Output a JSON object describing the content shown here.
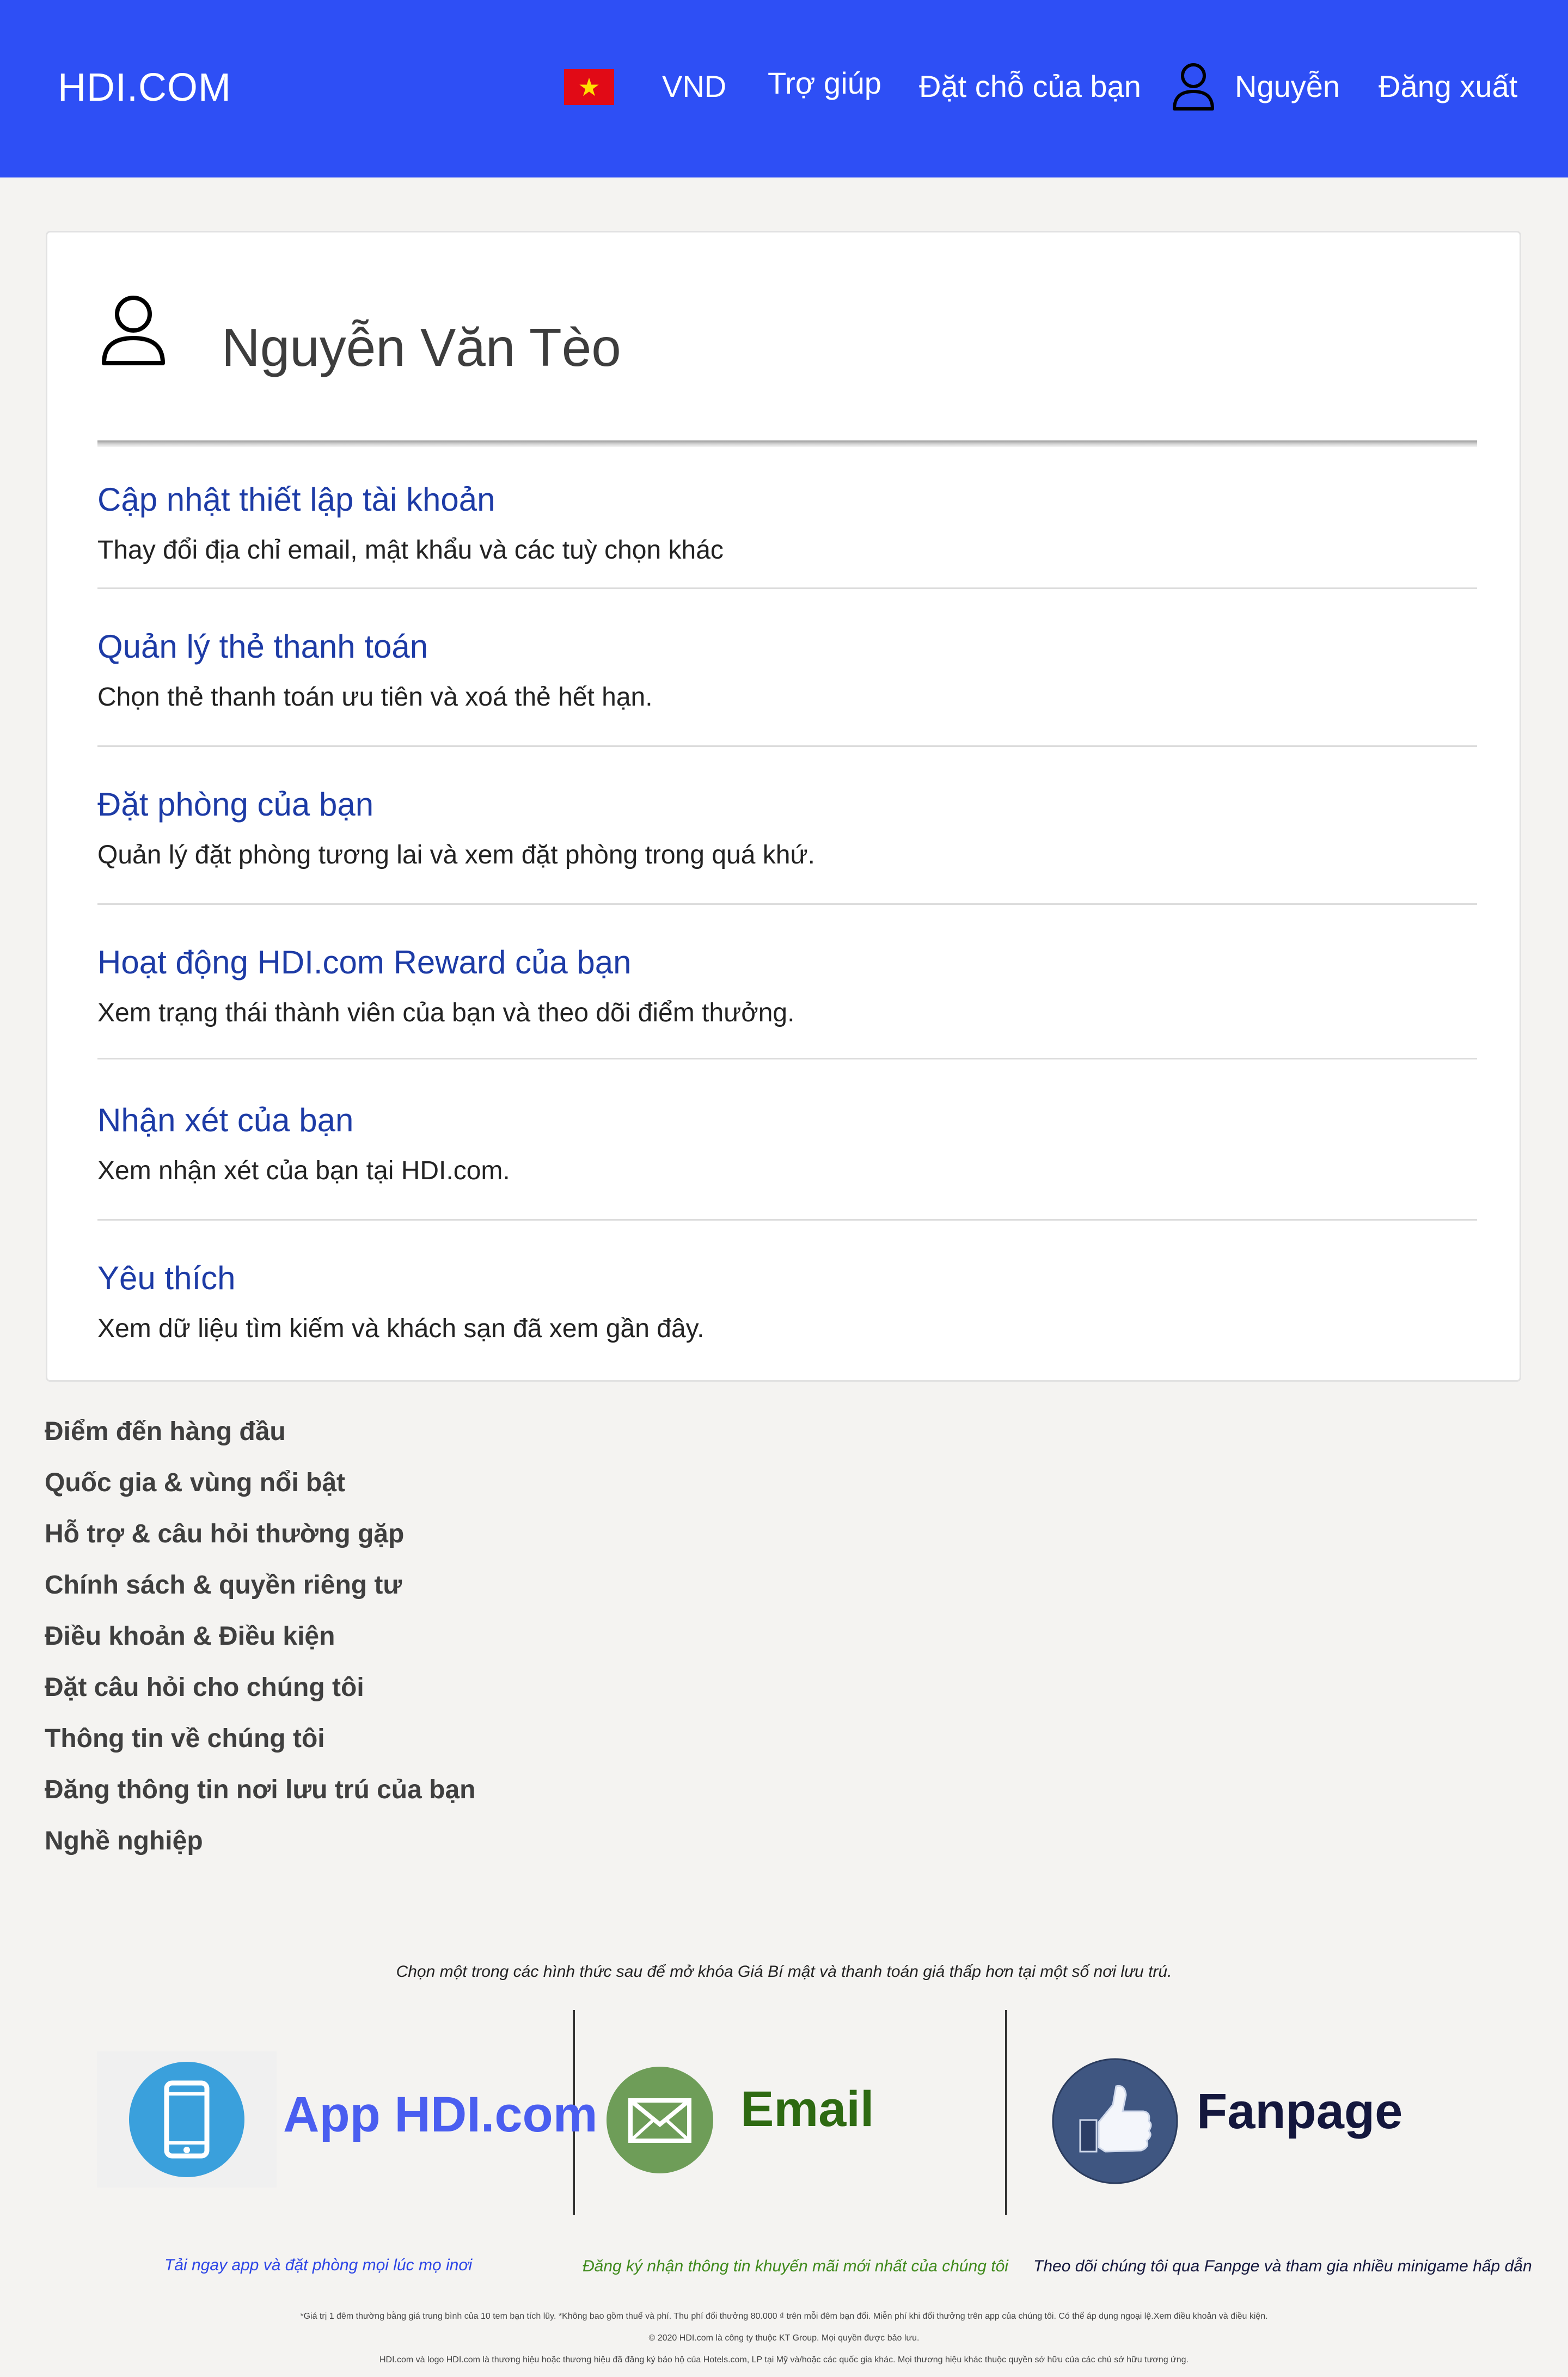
{
  "header": {
    "brand": "HDI.COM",
    "flag_star": "★",
    "currency": "VND",
    "help": "Trợ giúp",
    "bookings": "Đặt chỗ của bạn",
    "user_short": "Nguyễn",
    "logout": "Đăng xuất",
    "colors": {
      "bar": "#2e4ff5"
    }
  },
  "profile": {
    "name": "Nguyễn Văn Tèo",
    "menu": [
      {
        "title": "Cập nhật thiết lập tài khoản",
        "desc": "Thay đổi địa chỉ email, mật khẩu và các tuỳ chọn khác"
      },
      {
        "title": "Quản lý thẻ thanh toán",
        "desc": "Chọn thẻ thanh toán ưu tiên và xoá thẻ hết hạn."
      },
      {
        "title": "Đặt phòng của bạn",
        "desc": "Quản lý đặt phòng tương lai và xem đặt phòng trong quá khứ."
      },
      {
        "title": "Hoạt động HDI.com Reward của bạn",
        "desc": "Xem trạng thái thành viên của bạn và theo dõi điểm thưởng."
      },
      {
        "title": "Nhận xét của bạn",
        "desc": "Xem nhận xét của bạn tại HDI.com."
      },
      {
        "title": "Yêu thích",
        "desc": "Xem dữ liệu tìm kiếm và khách sạn đã xem gần đây."
      }
    ]
  },
  "footer": {
    "links": [
      "Điểm đến hàng đầu",
      "Quốc gia & vùng nổi bật",
      "Hỗ trợ & câu hỏi thường gặp",
      "Chính sách & quyền riêng tư",
      "Điều khoản & Điều kiện",
      "Đặt câu hỏi cho chúng tôi",
      "Thông tin về chúng tôi",
      "Đăng thông tin nơi lưu trú của bạn",
      "Nghề nghiệp"
    ]
  },
  "promo": {
    "intro": "Chọn một trong các hình thức sau để mở khóa Giá Bí mật và thanh toán giá thấp hơn tại một số nơi lưu trú.",
    "app": {
      "label": "App HDI.com",
      "caption": "Tải ngay app và đặt phòng mọi lúc mọ inơi",
      "color": "#4a5ef0"
    },
    "email": {
      "label": "Email",
      "caption": "Đăng ký nhận thông tin khuyến mãi mới nhất của chúng tôi",
      "color": "#2e6a12"
    },
    "fanpage": {
      "label": "Fanpage",
      "caption": "Theo dõi chúng tôi qua Fanpge và tham gia nhiều minigame hấp dẫn",
      "color": "#14173d"
    },
    "fine_print": [
      "*Giá trị 1 đêm thường bằng giá trung bình của 10 tem bạn tích lũy. *Không bao gồm thuế và phí. Thu phí đổi thưởng 80.000 ₫ trên mỗi đêm bạn đổi. Miễn phí khi đổi thưởng trên app của chúng tôi. Có thể áp dụng ngoại lệ.Xem điều khoản và điều kiện.",
      "© 2020 HDI.com là công ty thuộc KT Group. Mọi quyền được bảo lưu.",
      "HDI.com và logo HDI.com là thương hiệu hoặc thương hiệu đã đăng ký bảo hộ của Hotels.com, LP tại Mỹ và/hoặc các quốc gia khác. Mọi thương hiệu khác thuộc quyền sở hữu của các chủ sở hữu tương ứng."
    ]
  }
}
